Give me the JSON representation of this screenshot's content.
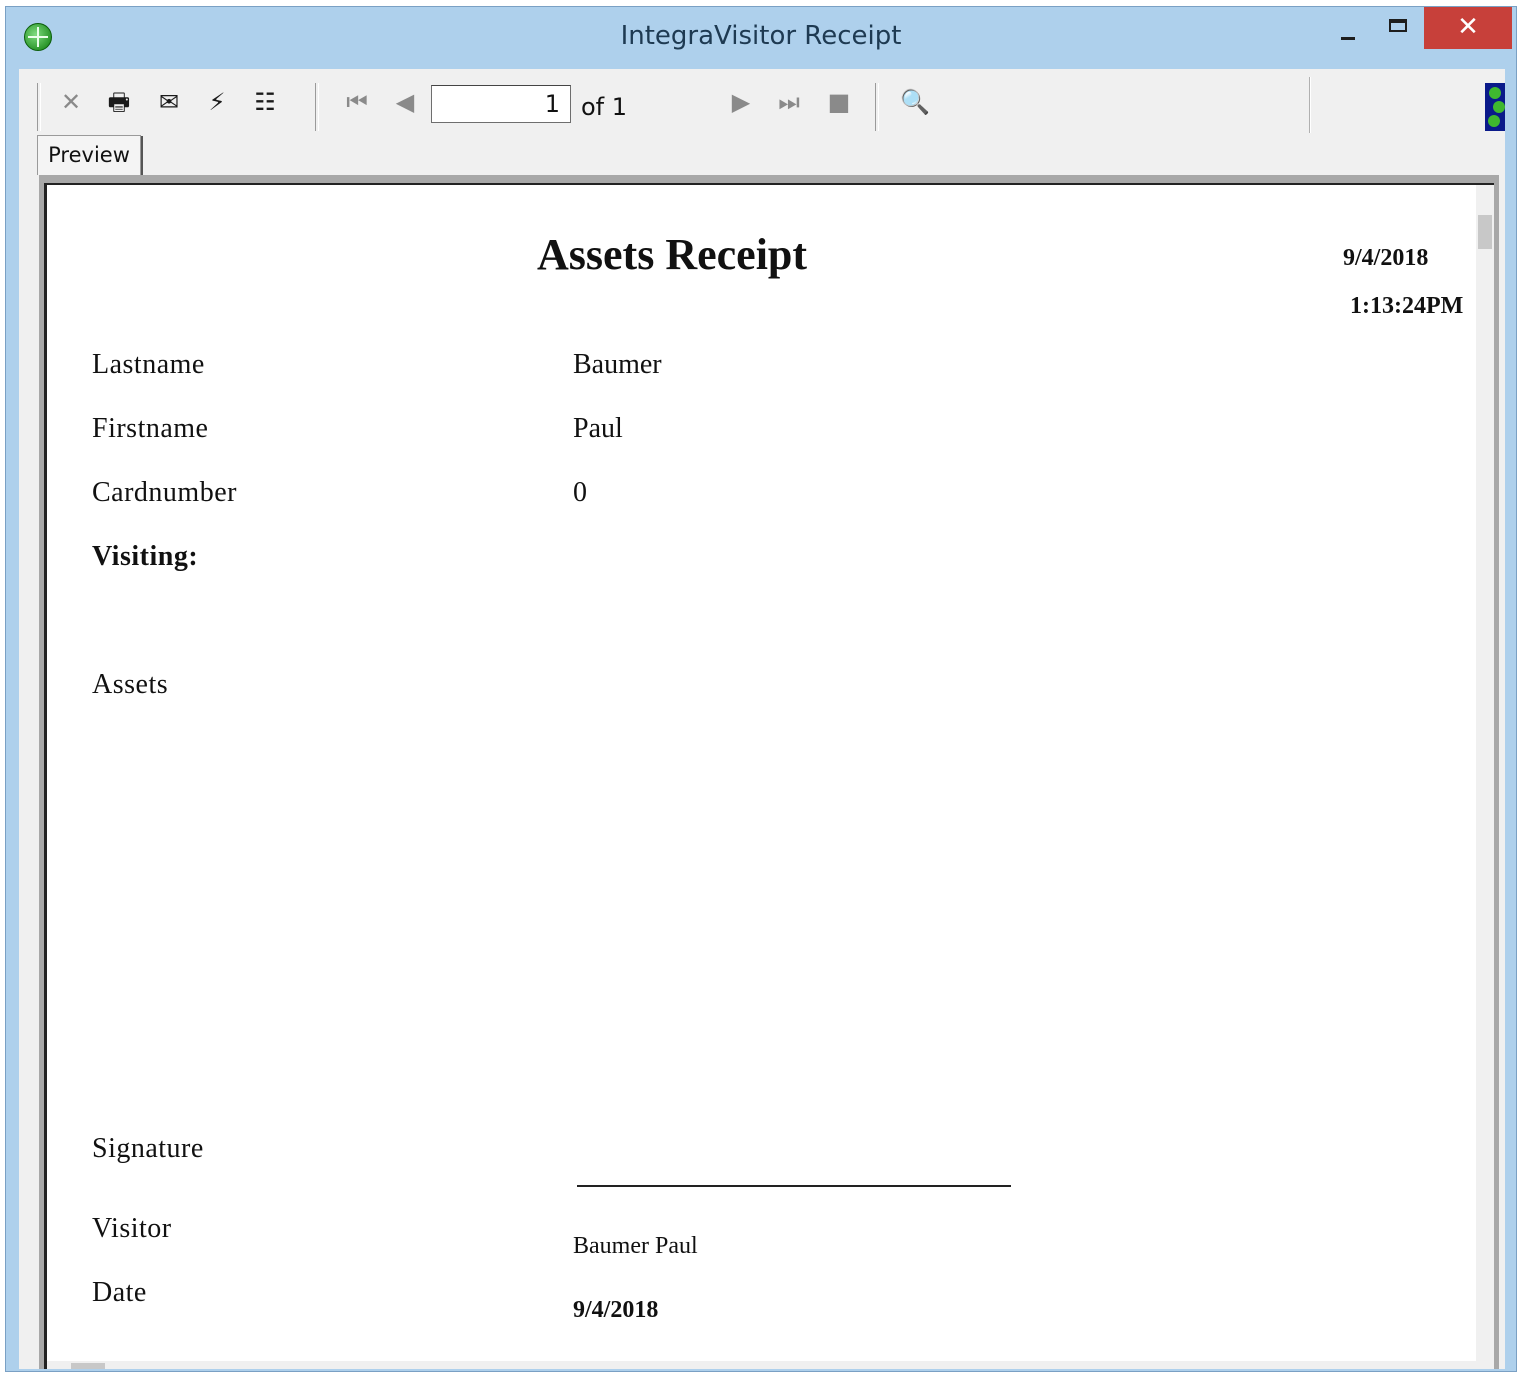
{
  "window": {
    "title": "IntegraVisitor Receipt",
    "close_glyph": "✕"
  },
  "toolbar": {
    "page_current": "1",
    "page_of": "of 1",
    "icons": {
      "close": "✕",
      "print": "🖶",
      "export": "✉",
      "refresh": "⚡",
      "tree": "☷",
      "first": "⏮",
      "prev": "◀",
      "next": "▶",
      "last": "⏭",
      "stop": "■",
      "search": "🔍"
    }
  },
  "tabs": {
    "preview": "Preview"
  },
  "report": {
    "title": "Assets Receipt",
    "date": "9/4/2018",
    "time": "1:13:24PM",
    "lastname_label": "Lastname",
    "lastname_value": "Baumer",
    "firstname_label": "Firstname",
    "firstname_value": "Paul",
    "cardnumber_label": "Cardnumber",
    "cardnumber_value": "0",
    "visiting_label": "Visiting:",
    "assets_label": "Assets",
    "signature_label": "Signature",
    "visitor_label": "Visitor",
    "visitor_value": "Baumer Paul",
    "date_label": "Date",
    "date_value": "9/4/2018"
  }
}
